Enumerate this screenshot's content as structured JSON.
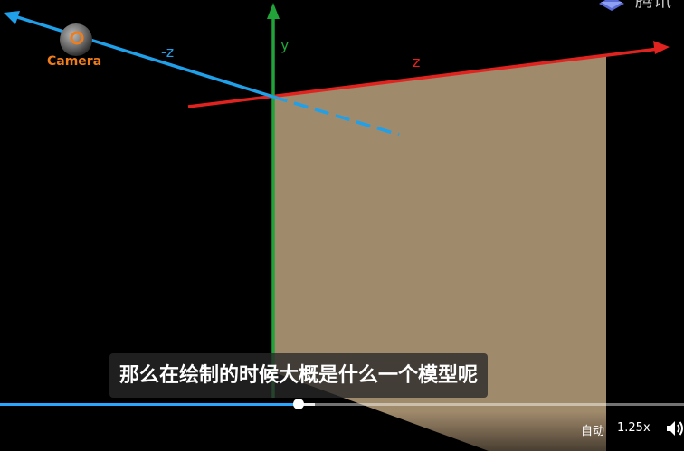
{
  "scene": {
    "axis_labels": {
      "neg_z": "-z",
      "y": "y",
      "z": "z"
    },
    "camera_label": "Camera",
    "colors": {
      "x_axis": "#e0231f",
      "y_axis": "#21a33a",
      "z_axis": "#1fa0e8",
      "plane": "#a08a6c",
      "camera": "#f07d1a"
    }
  },
  "watermark": {
    "text": "腾讯",
    "icon": "tencent-logo-icon"
  },
  "subtitle": "那么在绘制的时候大概是什么一个模型呢",
  "player": {
    "progress": 0.437,
    "buffered": 0.46,
    "controls": {
      "auto_label": "自动",
      "speed_label": "1.25x",
      "volume_icon": "volume-icon"
    }
  }
}
